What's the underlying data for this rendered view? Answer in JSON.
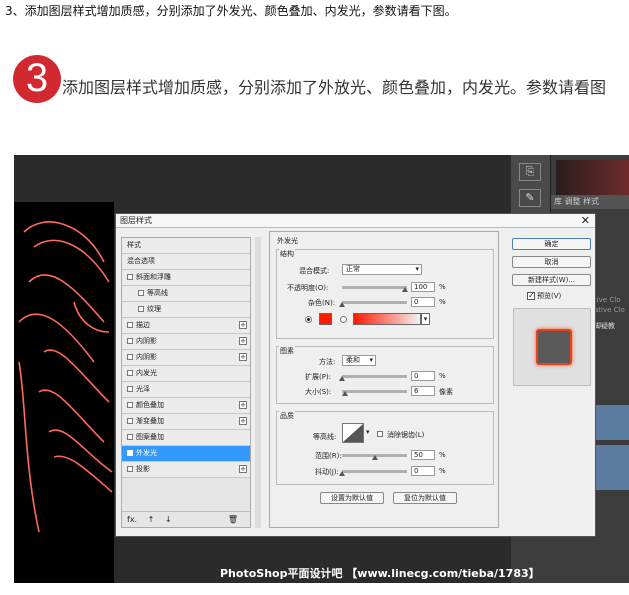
{
  "top_line": "3、添加图层样式增加质感，分别添加了外发光、颜色叠加、内发光，参数请看下图。",
  "step": {
    "number": "3",
    "text": "添加图层样式增加质感，分别添加了外放光、颜色叠加，内发光。参数请看图"
  },
  "watermark": "PhotoShop平面设计吧 【www.linecg.com/tieba/1783】",
  "ps_panel": {
    "tabs": "库  调整  样式",
    "cc_text_1": "tive Clo",
    "cc_text_2": "ative Clo",
    "side_text": "脚疑教"
  },
  "dialog": {
    "title": "图层样式",
    "close": "✕",
    "styles": [
      {
        "label": "样式",
        "checkbox": false,
        "plus": false,
        "indent": false,
        "selected": false
      },
      {
        "label": "混合选项",
        "checkbox": false,
        "plus": false,
        "indent": false,
        "selected": false
      },
      {
        "label": "斜面和浮雕",
        "checkbox": true,
        "plus": false,
        "indent": false,
        "selected": false
      },
      {
        "label": "等高线",
        "checkbox": true,
        "plus": false,
        "indent": true,
        "selected": false
      },
      {
        "label": "纹理",
        "checkbox": true,
        "plus": false,
        "indent": true,
        "selected": false
      },
      {
        "label": "描边",
        "checkbox": true,
        "plus": true,
        "indent": false,
        "selected": false
      },
      {
        "label": "内阴影",
        "checkbox": true,
        "plus": true,
        "indent": false,
        "selected": false
      },
      {
        "label": "内阴影",
        "checkbox": true,
        "plus": true,
        "indent": false,
        "selected": false
      },
      {
        "label": "内发光",
        "checkbox": true,
        "plus": false,
        "indent": false,
        "selected": false
      },
      {
        "label": "光泽",
        "checkbox": true,
        "plus": false,
        "indent": false,
        "selected": false
      },
      {
        "label": "颜色叠加",
        "checkbox": true,
        "plus": true,
        "indent": false,
        "selected": false
      },
      {
        "label": "渐变叠加",
        "checkbox": true,
        "plus": true,
        "indent": false,
        "selected": false
      },
      {
        "label": "图案叠加",
        "checkbox": true,
        "plus": false,
        "indent": false,
        "selected": false
      },
      {
        "label": "外发光",
        "checkbox": true,
        "plus": false,
        "indent": false,
        "selected": true
      },
      {
        "label": "投影",
        "checkbox": true,
        "plus": true,
        "indent": false,
        "selected": false
      }
    ],
    "footer_icons": [
      "fx.",
      "↑",
      "↓",
      "🗑"
    ],
    "outer_glow": {
      "section": "外发光",
      "structure_label": "结构",
      "blend_mode_label": "混合模式:",
      "blend_mode_value": "正常",
      "opacity_label": "不透明度(O):",
      "opacity_value": "100",
      "noise_label": "杂色(N):",
      "noise_value": "0",
      "percent": "%",
      "glow_color": "#ff1a00",
      "elements_label": "图素",
      "method_label": "方法:",
      "method_value": "柔和",
      "spread_label": "扩展(P):",
      "spread_value": "0",
      "size_label": "大小(S):",
      "size_value": "6",
      "size_unit": "像素",
      "quality_label": "品质",
      "contour_label": "等高线:",
      "antialias_label": "消除锯齿(L)",
      "range_label": "范围(R):",
      "range_value": "50",
      "jitter_label": "抖动(J):",
      "jitter_value": "0",
      "make_default": "设置为默认值",
      "reset_default": "复位为默认值"
    },
    "buttons": {
      "ok": "确定",
      "cancel": "取消",
      "new_style": "新建样式(W)...",
      "preview_label": "预览(V)"
    }
  }
}
